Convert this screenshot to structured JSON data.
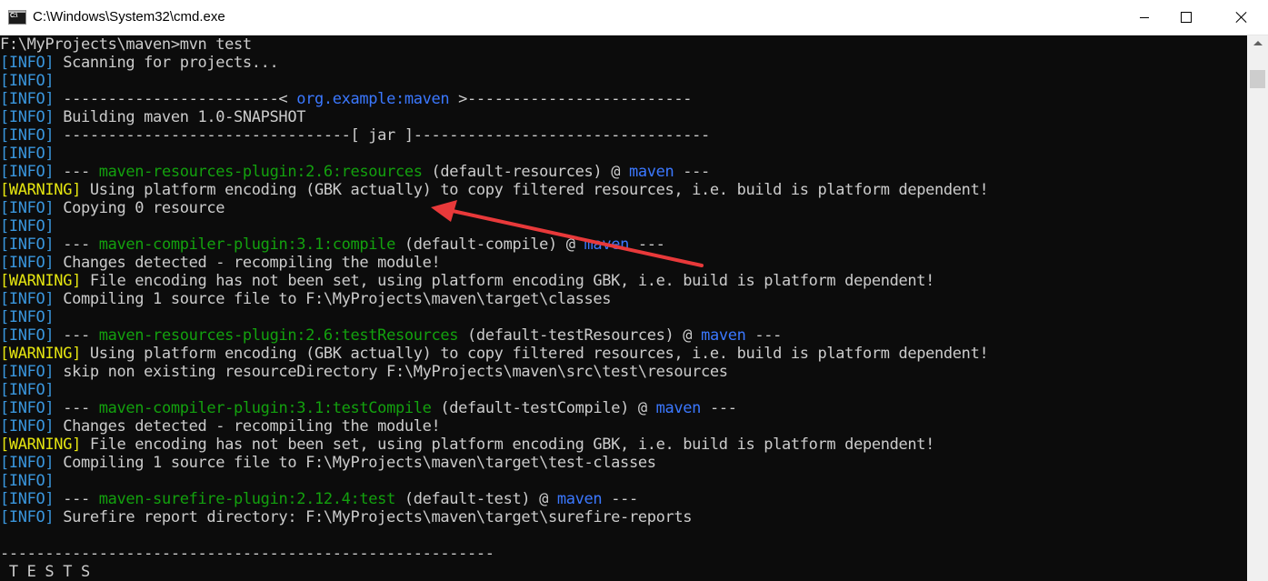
{
  "window": {
    "title": "C:\\Windows\\System32\\cmd.exe"
  },
  "console": {
    "lines": [
      [
        {
          "t": "F:\\MyProjects\\maven>mvn test",
          "c": "text"
        }
      ],
      [
        {
          "t": "[INFO]",
          "c": "info"
        },
        {
          "t": " Scanning for projects...",
          "c": "text"
        }
      ],
      [
        {
          "t": "[INFO]",
          "c": "info"
        }
      ],
      [
        {
          "t": "[INFO]",
          "c": "info"
        },
        {
          "t": " ------------------------< ",
          "c": "text"
        },
        {
          "t": "org.example:maven",
          "c": "blue"
        },
        {
          "t": " >-------------------------",
          "c": "text"
        }
      ],
      [
        {
          "t": "[INFO]",
          "c": "info"
        },
        {
          "t": " Building maven 1.0-SNAPSHOT",
          "c": "text"
        }
      ],
      [
        {
          "t": "[INFO]",
          "c": "info"
        },
        {
          "t": " --------------------------------[ jar ]---------------------------------",
          "c": "text"
        }
      ],
      [
        {
          "t": "[INFO]",
          "c": "info"
        }
      ],
      [
        {
          "t": "[INFO]",
          "c": "info"
        },
        {
          "t": " --- ",
          "c": "text"
        },
        {
          "t": "maven-resources-plugin:2.6:resources",
          "c": "green"
        },
        {
          "t": " (default-resources) @ ",
          "c": "text"
        },
        {
          "t": "maven",
          "c": "blue"
        },
        {
          "t": " ---",
          "c": "text"
        }
      ],
      [
        {
          "t": "[WARNING]",
          "c": "warn"
        },
        {
          "t": " Using platform encoding (GBK actually) to copy filtered resources, i.e. build is platform dependent!",
          "c": "text"
        }
      ],
      [
        {
          "t": "[INFO]",
          "c": "info"
        },
        {
          "t": " Copying 0 resource",
          "c": "text"
        }
      ],
      [
        {
          "t": "[INFO]",
          "c": "info"
        }
      ],
      [
        {
          "t": "[INFO]",
          "c": "info"
        },
        {
          "t": " --- ",
          "c": "text"
        },
        {
          "t": "maven-compiler-plugin:3.1:compile",
          "c": "green"
        },
        {
          "t": " (default-compile) @ ",
          "c": "text"
        },
        {
          "t": "maven",
          "c": "blue"
        },
        {
          "t": " ---",
          "c": "text"
        }
      ],
      [
        {
          "t": "[INFO]",
          "c": "info"
        },
        {
          "t": " Changes detected - recompiling the module!",
          "c": "text"
        }
      ],
      [
        {
          "t": "[WARNING]",
          "c": "warn"
        },
        {
          "t": " File encoding has not been set, using platform encoding GBK, i.e. build is platform dependent!",
          "c": "text"
        }
      ],
      [
        {
          "t": "[INFO]",
          "c": "info"
        },
        {
          "t": " Compiling 1 source file to F:\\MyProjects\\maven\\target\\classes",
          "c": "text"
        }
      ],
      [
        {
          "t": "[INFO]",
          "c": "info"
        }
      ],
      [
        {
          "t": "[INFO]",
          "c": "info"
        },
        {
          "t": " --- ",
          "c": "text"
        },
        {
          "t": "maven-resources-plugin:2.6:testResources",
          "c": "green"
        },
        {
          "t": " (default-testResources) @ ",
          "c": "text"
        },
        {
          "t": "maven",
          "c": "blue"
        },
        {
          "t": " ---",
          "c": "text"
        }
      ],
      [
        {
          "t": "[WARNING]",
          "c": "warn"
        },
        {
          "t": " Using platform encoding (GBK actually) to copy filtered resources, i.e. build is platform dependent!",
          "c": "text"
        }
      ],
      [
        {
          "t": "[INFO]",
          "c": "info"
        },
        {
          "t": " skip non existing resourceDirectory F:\\MyProjects\\maven\\src\\test\\resources",
          "c": "text"
        }
      ],
      [
        {
          "t": "[INFO]",
          "c": "info"
        }
      ],
      [
        {
          "t": "[INFO]",
          "c": "info"
        },
        {
          "t": " --- ",
          "c": "text"
        },
        {
          "t": "maven-compiler-plugin:3.1:testCompile",
          "c": "green"
        },
        {
          "t": " (default-testCompile) @ ",
          "c": "text"
        },
        {
          "t": "maven",
          "c": "blue"
        },
        {
          "t": " ---",
          "c": "text"
        }
      ],
      [
        {
          "t": "[INFO]",
          "c": "info"
        },
        {
          "t": " Changes detected - recompiling the module!",
          "c": "text"
        }
      ],
      [
        {
          "t": "[WARNING]",
          "c": "warn"
        },
        {
          "t": " File encoding has not been set, using platform encoding GBK, i.e. build is platform dependent!",
          "c": "text"
        }
      ],
      [
        {
          "t": "[INFO]",
          "c": "info"
        },
        {
          "t": " Compiling 1 source file to F:\\MyProjects\\maven\\target\\test-classes",
          "c": "text"
        }
      ],
      [
        {
          "t": "[INFO]",
          "c": "info"
        }
      ],
      [
        {
          "t": "[INFO]",
          "c": "info"
        },
        {
          "t": " --- ",
          "c": "text"
        },
        {
          "t": "maven-surefire-plugin:2.12.4:test",
          "c": "green"
        },
        {
          "t": " (default-test) @ ",
          "c": "text"
        },
        {
          "t": "maven",
          "c": "blue"
        },
        {
          "t": " ---",
          "c": "text"
        }
      ],
      [
        {
          "t": "[INFO]",
          "c": "info"
        },
        {
          "t": " Surefire report directory: F:\\MyProjects\\maven\\target\\surefire-reports",
          "c": "text"
        }
      ],
      [],
      [
        {
          "t": "-------------------------------------------------------",
          "c": "text"
        }
      ],
      [
        {
          "t": " T E S T S",
          "c": "text"
        }
      ]
    ]
  },
  "colors": {
    "background": "#0c0c0c",
    "text": "#cccccc",
    "info": "#3a96dd",
    "warning": "#e5e510",
    "plugin": "#13a10e",
    "artifact": "#3b78ff",
    "annotation_arrow": "#e8393a"
  },
  "icons": [
    "cmd-app-icon",
    "minimize-icon",
    "maximize-icon",
    "close-icon",
    "scroll-up-arrow-icon"
  ]
}
